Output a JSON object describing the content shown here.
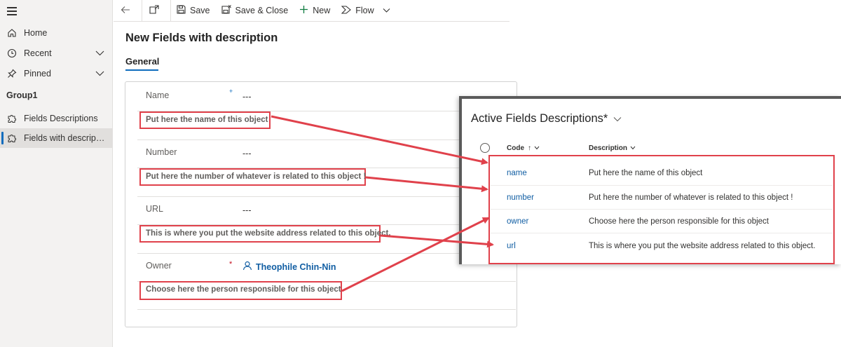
{
  "sidebar": {
    "home": "Home",
    "recent": "Recent",
    "pinned": "Pinned",
    "group": "Group1",
    "items": [
      {
        "label": "Fields Descriptions"
      },
      {
        "label": "Fields with descriptio..."
      }
    ]
  },
  "toolbar": {
    "save": "Save",
    "save_close": "Save & Close",
    "new": "New",
    "flow": "Flow"
  },
  "form": {
    "title": "New Fields with description",
    "tab": "General",
    "fields": [
      {
        "label": "Name",
        "value": "---",
        "required_marker": "+",
        "description": "Put here the name of this object"
      },
      {
        "label": "Number",
        "value": "---",
        "description": "Put here the number of whatever is related to this object !"
      },
      {
        "label": "URL",
        "value": "---",
        "description": "This is where you put the website address related to this object."
      },
      {
        "label": "Owner",
        "value": "Theophile Chin-Nin",
        "required_marker": "*",
        "description": "Choose here the person responsible for this object"
      }
    ]
  },
  "view": {
    "title": "Active Fields Descriptions*",
    "columns": {
      "code": "Code",
      "code_sort": "↑",
      "description": "Description"
    },
    "rows": [
      {
        "code": "name",
        "description": "Put here the name of this object"
      },
      {
        "code": "number",
        "description": "Put here the number of whatever is related to this object !"
      },
      {
        "code": "owner",
        "description": "Choose here the person responsible for this object"
      },
      {
        "code": "url",
        "description": "This is where you put the website address related to this object."
      }
    ]
  },
  "colors": {
    "accent": "#0f6cbd",
    "link": "#115ea3",
    "annotation": "#e0414b",
    "required": "#c50f1f"
  }
}
